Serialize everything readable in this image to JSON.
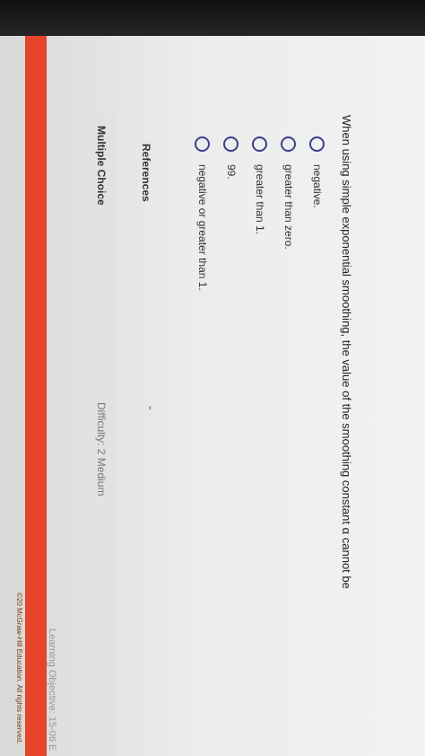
{
  "question": {
    "text": "When using simple exponential smoothing, the value of the smoothing constant α cannot be"
  },
  "options": [
    {
      "label": "negative."
    },
    {
      "label": "greater than zero."
    },
    {
      "label": "greater than 1."
    },
    {
      "label": "99."
    },
    {
      "label": "negative or greater than 1."
    }
  ],
  "references": {
    "label": "References"
  },
  "meta": {
    "type": "Multiple Choice",
    "difficulty": "Difficulty: 2 Medium",
    "learning_objective": "Learning Objective: 15-06 E"
  },
  "footer": {
    "copyright": "©20 McGraw-Hill Education. All rights reserved."
  },
  "colors": {
    "accent_strip": "#e5452b",
    "radio_border": "#3a3f8c"
  }
}
